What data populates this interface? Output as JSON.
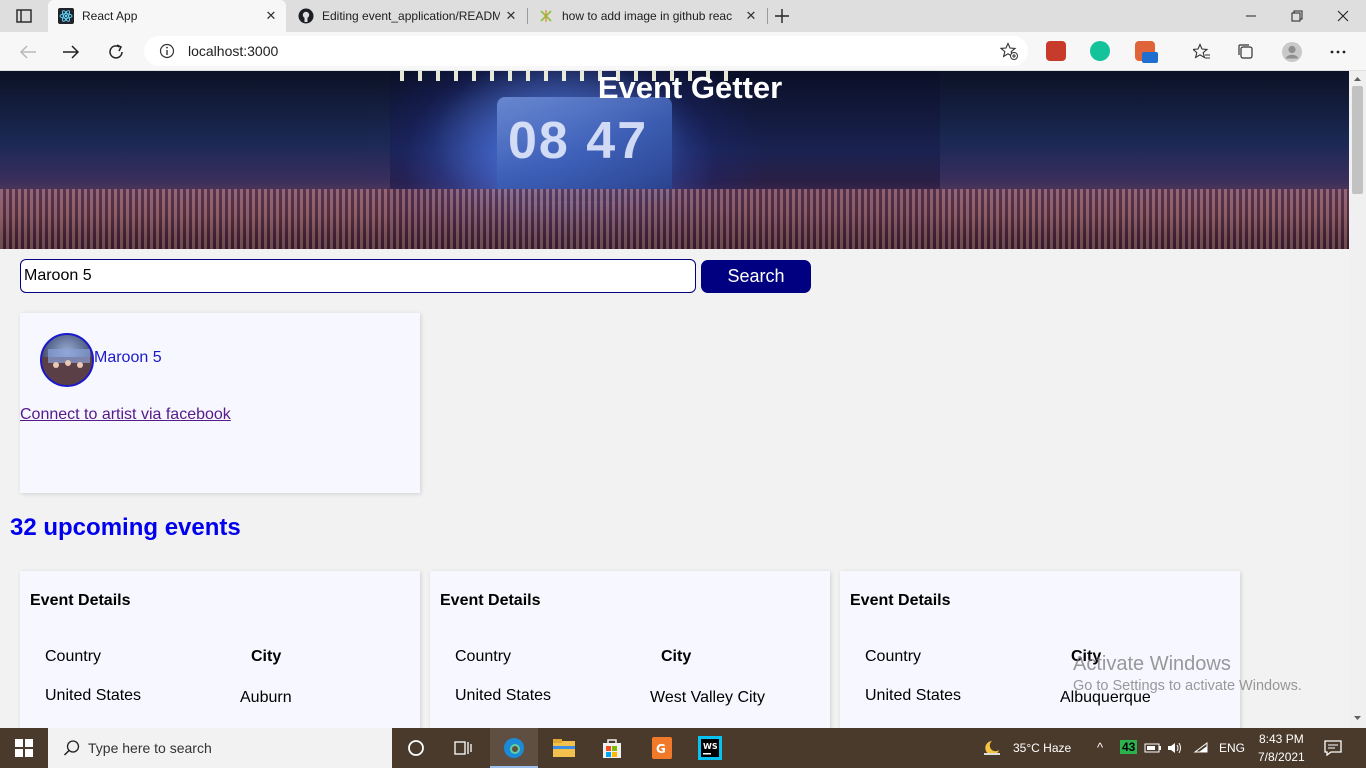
{
  "browser": {
    "tabs": [
      {
        "title": "React App",
        "active": true,
        "favicon": "react-icon"
      },
      {
        "title": "Editing event_application/READM",
        "active": false,
        "favicon": "github-icon"
      },
      {
        "title": "how to add image in github reac",
        "active": false,
        "favicon": "stackoverflow-icon"
      }
    ],
    "url": "localhost:3000"
  },
  "page": {
    "hero_title": "Event Getter",
    "hero_clock": "08 47",
    "search": {
      "value": "Maroon 5",
      "button_label": "Search"
    },
    "artist": {
      "name": "Maroon 5",
      "facebook_link_text": "Connect to artist via facebook"
    },
    "events_heading": "32 upcoming events",
    "events": [
      {
        "title": "Event Details",
        "country_label": "Country",
        "city_label": "City",
        "country": "United States",
        "city": "Auburn"
      },
      {
        "title": "Event Details",
        "country_label": "Country",
        "city_label": "City",
        "country": "United States",
        "city": "West Valley City"
      },
      {
        "title": "Event Details",
        "country_label": "Country",
        "city_label": "City",
        "country": "United States",
        "city": "Albuquerque"
      }
    ],
    "link_color": "#1a1acc",
    "accent_color": "#000080"
  },
  "watermark": {
    "line1": "Activate Windows",
    "line2": "Go to Settings to activate Windows."
  },
  "taskbar": {
    "search_placeholder": "Type here to search",
    "weather": "35°C  Haze",
    "badge": "43",
    "language": "ENG",
    "time": "8:43 PM",
    "date": "7/8/2021"
  }
}
